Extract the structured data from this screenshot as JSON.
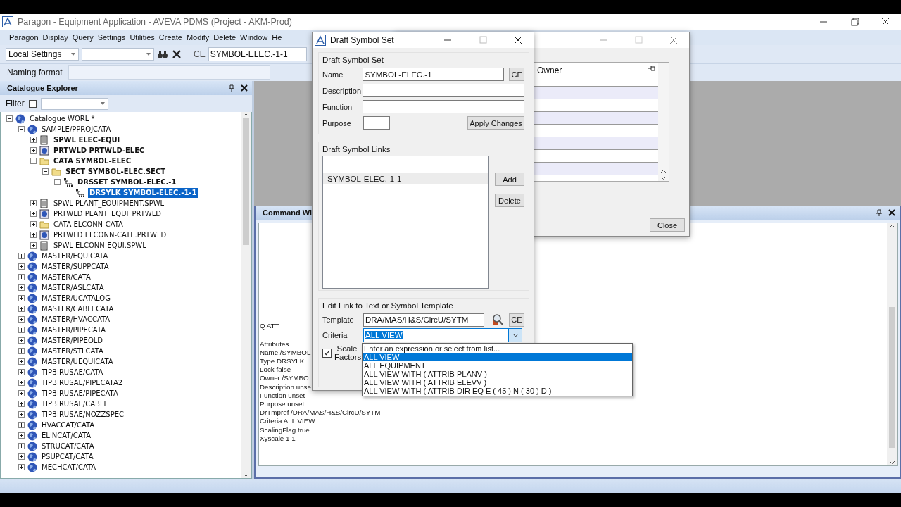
{
  "window": {
    "title": "Paragon - Equipment Application -  AVEVA PDMS (Project - AKM-Prod)"
  },
  "menu": [
    "Paragon",
    "Display",
    "Query",
    "Settings",
    "Utilities",
    "Create",
    "Modify",
    "Delete",
    "Window",
    "He"
  ],
  "toolbar": {
    "settings_combo": "Local Settings",
    "ce_label": "CE",
    "ce_value": "SYMBOL-ELEC.-1-1"
  },
  "naming_format": {
    "label": "Naming format"
  },
  "explorer": {
    "title": "Catalogue Explorer",
    "filter_label": "Filter",
    "filter_checked": false,
    "tree": [
      {
        "label": "Catalogue WORL *",
        "kind": "world",
        "expanded": true,
        "emphasized": false,
        "selected": false,
        "children": [
          {
            "label": "SAMPLE/PPROJCATA",
            "kind": "world",
            "expanded": true,
            "emphasized": false,
            "selected": false,
            "children": [
              {
                "label": "SPWL ELEC-EQUI",
                "kind": "spec",
                "expanded": false,
                "emphasized": true,
                "selected": false
              },
              {
                "label": "PRTWLD PRTWLD-ELEC",
                "kind": "weld",
                "expanded": false,
                "emphasized": true,
                "selected": false
              },
              {
                "label": "CATA SYMBOL-ELEC",
                "kind": "folder",
                "expanded": true,
                "emphasized": true,
                "selected": false,
                "children": [
                  {
                    "label": "SECT SYMBOL-ELEC.SECT",
                    "kind": "folder",
                    "expanded": true,
                    "emphasized": true,
                    "selected": false,
                    "children": [
                      {
                        "label": "DRSSET SYMBOL-ELEC.-1",
                        "kind": "hierarchy",
                        "expanded": true,
                        "emphasized": true,
                        "selected": false,
                        "children": [
                          {
                            "label": "DRSYLK SYMBOL-ELEC.-1-1",
                            "kind": "hierarchy",
                            "emphasized": true,
                            "selected": true
                          }
                        ]
                      }
                    ]
                  }
                ]
              },
              {
                "label": "SPWL PLANT_EQUIPMENT.SPWL",
                "kind": "spec",
                "expanded": false,
                "emphasized": false,
                "selected": false
              },
              {
                "label": "PRTWLD PLANT_EQUI_PRTWLD",
                "kind": "weld",
                "expanded": false,
                "emphasized": false,
                "selected": false
              },
              {
                "label": "CATA ELCONN-CATA",
                "kind": "folder",
                "expanded": false,
                "emphasized": false,
                "selected": false
              },
              {
                "label": "PRTWLD ELCONN-CATE.PRTWLD",
                "kind": "weld",
                "expanded": false,
                "emphasized": false,
                "selected": false
              },
              {
                "label": "SPWL ELCONN-EQUI.SPWL",
                "kind": "spec",
                "expanded": false,
                "emphasized": false,
                "selected": false
              }
            ]
          },
          {
            "label": "MASTER/EQUICATA",
            "kind": "world",
            "expanded": false,
            "emphasized": false,
            "selected": false
          },
          {
            "label": "MASTER/SUPPCATA",
            "kind": "world",
            "expanded": false,
            "emphasized": false,
            "selected": false
          },
          {
            "label": "MASTER/CATA",
            "kind": "world",
            "expanded": false,
            "emphasized": false,
            "selected": false
          },
          {
            "label": "MASTER/ASLCATA",
            "kind": "world",
            "expanded": false,
            "emphasized": false,
            "selected": false
          },
          {
            "label": "MASTER/UCATALOG",
            "kind": "world",
            "expanded": false,
            "emphasized": false,
            "selected": false
          },
          {
            "label": "MASTER/CABLECATA",
            "kind": "world",
            "expanded": false,
            "emphasized": false,
            "selected": false
          },
          {
            "label": "MASTER/HVACCATA",
            "kind": "world",
            "expanded": false,
            "emphasized": false,
            "selected": false
          },
          {
            "label": "MASTER/PIPECATA",
            "kind": "world",
            "expanded": false,
            "emphasized": false,
            "selected": false
          },
          {
            "label": "MASTER/PIPEOLD",
            "kind": "world",
            "expanded": false,
            "emphasized": false,
            "selected": false
          },
          {
            "label": "MASTER/STLCATA",
            "kind": "world",
            "expanded": false,
            "emphasized": false,
            "selected": false
          },
          {
            "label": "MASTER/UEQUICATA",
            "kind": "world",
            "expanded": false,
            "emphasized": false,
            "selected": false
          },
          {
            "label": "TIPBIRUSAE/CATA",
            "kind": "world",
            "expanded": false,
            "emphasized": false,
            "selected": false
          },
          {
            "label": "TIPBIRUSAE/PIPECATA2",
            "kind": "world",
            "expanded": false,
            "emphasized": false,
            "selected": false
          },
          {
            "label": "TIPBIRUSAE/PIPECATA",
            "kind": "world",
            "expanded": false,
            "emphasized": false,
            "selected": false
          },
          {
            "label": "TIPBIRUSAE/CABLE",
            "kind": "world",
            "expanded": false,
            "emphasized": false,
            "selected": false
          },
          {
            "label": "TIPBIRUSAE/NOZZSPEC",
            "kind": "world",
            "expanded": false,
            "emphasized": false,
            "selected": false
          },
          {
            "label": "HVACCAT/CATA",
            "kind": "world",
            "expanded": false,
            "emphasized": false,
            "selected": false
          },
          {
            "label": "ELINCAT/CATA",
            "kind": "world",
            "expanded": false,
            "emphasized": false,
            "selected": false
          },
          {
            "label": "STRUCAT/CATA",
            "kind": "world",
            "expanded": false,
            "emphasized": false,
            "selected": false
          },
          {
            "label": "PSUPCAT/CATA",
            "kind": "world",
            "expanded": false,
            "emphasized": false,
            "selected": false
          },
          {
            "label": "MECHCAT/CATA",
            "kind": "world",
            "expanded": false,
            "emphasized": false,
            "selected": false
          }
        ]
      }
    ]
  },
  "command_window": {
    "title": "Command Wi",
    "lines": [
      {
        "text": "Q ATT",
        "kind": "command"
      },
      {
        "text": "Attributes",
        "kind": "output"
      },
      {
        "text": "Name /SYMBOL",
        "kind": "output"
      },
      {
        "text": "Type DRSYLK",
        "kind": "output"
      },
      {
        "text": "Lock false",
        "kind": "output"
      },
      {
        "text": "Owner /SYMBO",
        "kind": "output"
      },
      {
        "text": "Description unse",
        "kind": "output"
      },
      {
        "text": "Function unset",
        "kind": "output"
      },
      {
        "text": "Purpose unset",
        "kind": "output"
      },
      {
        "text": "DrTmpref /DRA/MAS/H&S/CircU/SYTM",
        "kind": "output"
      },
      {
        "text": "Criteria  ALL VIEW",
        "kind": "output"
      },
      {
        "text": "ScalingFlag true",
        "kind": "output"
      },
      {
        "text": "Xyscale 1 1",
        "kind": "output"
      }
    ]
  },
  "back_dialog": {
    "column": "Owner",
    "close_button": "Close"
  },
  "dialog": {
    "title": "Draft Symbol Set",
    "set_group": "Draft Symbol Set",
    "fields": [
      {
        "label": "Name",
        "value": "SYMBOL-ELEC.-1",
        "kind": "ce"
      },
      {
        "label": "Description",
        "kind": "wide"
      },
      {
        "label": "Function",
        "kind": "wide"
      },
      {
        "label": "Purpose",
        "kind": "short"
      }
    ],
    "ce_button": "CE",
    "apply_button": "Apply Changes",
    "links_group": "Draft Symbol Links",
    "links": [
      {
        "text": "SYMBOL-ELEC.-1-1",
        "selected": true
      }
    ],
    "add_button": "Add",
    "delete_button": "Delete",
    "template_group": "Edit Link to Text or Symbol Template",
    "template_label": "Template",
    "template_value": "DRA/MAS/H&S/CircU/SYTM",
    "template_ce": "CE",
    "criteria_label": "Criteria",
    "criteria_value": "ALL VIEW",
    "criteria_highlighted": true,
    "scale_label": "Scale Factors",
    "scale_checked": true,
    "dropdown": [
      {
        "text": "Enter an expression or select from list...",
        "selected": false
      },
      {
        "text": "ALL VIEW",
        "selected": true
      },
      {
        "text": "ALL EQUIPMENT",
        "selected": false
      },
      {
        "text": "ALL VIEW WITH ( ATTRIB PLANV )",
        "selected": false
      },
      {
        "text": "ALL VIEW WITH ( ATTRIB ELEVV )",
        "selected": false
      },
      {
        "text": "ALL VIEW WITH ( ATTRIB DIR EQ E ( 45 ) N ( 30 ) D )",
        "selected": false
      }
    ]
  }
}
